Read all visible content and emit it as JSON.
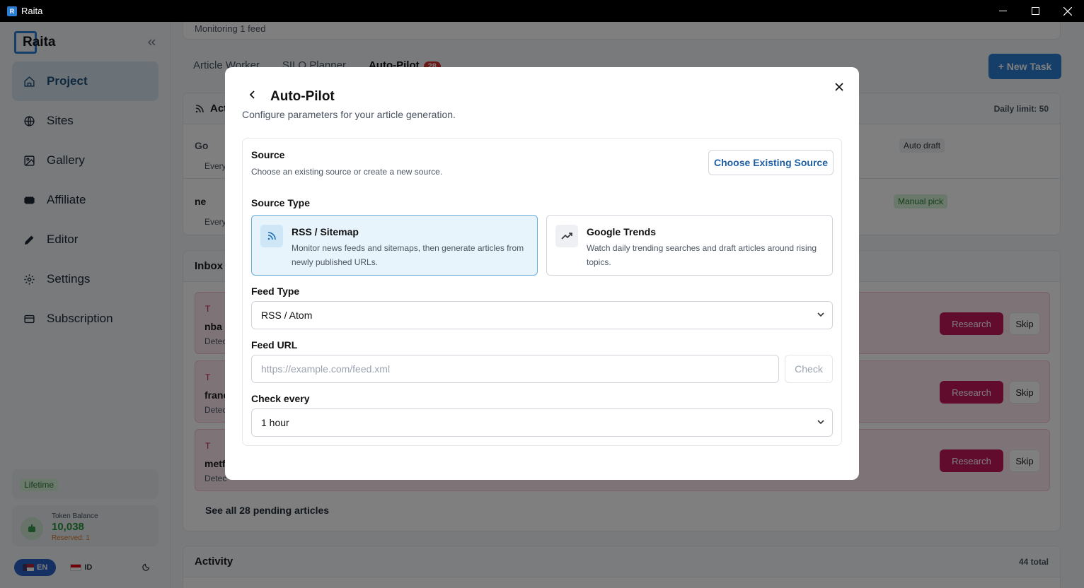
{
  "window": {
    "title": "Raita"
  },
  "sidebar": {
    "logo_text": "Raita",
    "items": [
      {
        "label": "Project",
        "icon": "home-icon",
        "active": true
      },
      {
        "label": "Sites",
        "icon": "globe-icon"
      },
      {
        "label": "Gallery",
        "icon": "image-icon"
      },
      {
        "label": "Affiliate",
        "icon": "ticket-icon"
      },
      {
        "label": "Editor",
        "icon": "pencil-icon"
      },
      {
        "label": "Settings",
        "icon": "gear-icon"
      },
      {
        "label": "Subscription",
        "icon": "card-icon"
      }
    ],
    "plan_badge": "Lifetime",
    "token": {
      "label": "Token Balance",
      "value": "10,038",
      "reserved": "Reserved: 1"
    },
    "languages": [
      {
        "code": "EN",
        "active": true
      },
      {
        "code": "ID",
        "active": false
      }
    ]
  },
  "main": {
    "monitor_text": "Monitoring 1 feed",
    "tabs": [
      {
        "label": "Article Worker"
      },
      {
        "label": "SILO Planner"
      },
      {
        "label": "Auto-Pilot",
        "badge": "28",
        "active": true
      }
    ],
    "new_task_label": "+ New Task",
    "active_card": {
      "title_partial": "Act",
      "daily_limit": "Daily limit: 50",
      "rows": [
        {
          "name_partial": "Go",
          "sub_partial": "Every",
          "chip": "Auto draft"
        },
        {
          "name_partial": "ne",
          "sub_partial": "Every",
          "chip": "Manual pick"
        }
      ]
    },
    "inbox": {
      "title": "Inbox",
      "rows": [
        {
          "tag_partial": "T",
          "title_partial": "nba e",
          "sub_partial": "Detec"
        },
        {
          "tag_partial": "T",
          "title_partial": "franc",
          "sub_partial": "Detec"
        },
        {
          "tag_partial": "T",
          "title_partial": "metf",
          "sub_partial": "Detec"
        }
      ],
      "research_label": "Research",
      "skip_label": "Skip",
      "see_all": "See all 28 pending articles"
    },
    "activity": {
      "title": "Activity",
      "total": "44 total"
    }
  },
  "modal": {
    "title": "Auto-Pilot",
    "subtitle": "Configure parameters for your article generation.",
    "source_label": "Source",
    "source_desc": "Choose an existing source or create a new source.",
    "choose_button": "Choose Existing Source",
    "source_type_label": "Source Type",
    "options": [
      {
        "title": "RSS / Sitemap",
        "desc": "Monitor news feeds and sitemaps, then generate articles from newly published URLs.",
        "selected": true
      },
      {
        "title": "Google Trends",
        "desc": "Watch daily trending searches and draft articles around rising topics.",
        "selected": false
      }
    ],
    "feed_type_label": "Feed Type",
    "feed_type_value": "RSS / Atom",
    "feed_url_label": "Feed URL",
    "feed_url_placeholder": "https://example.com/feed.xml",
    "check_button": "Check",
    "check_every_label": "Check every",
    "check_every_value": "1 hour"
  },
  "colors": {
    "accent": "#2b7cd3",
    "research": "#c2185b",
    "selected_bg": "#e8f4fb"
  }
}
